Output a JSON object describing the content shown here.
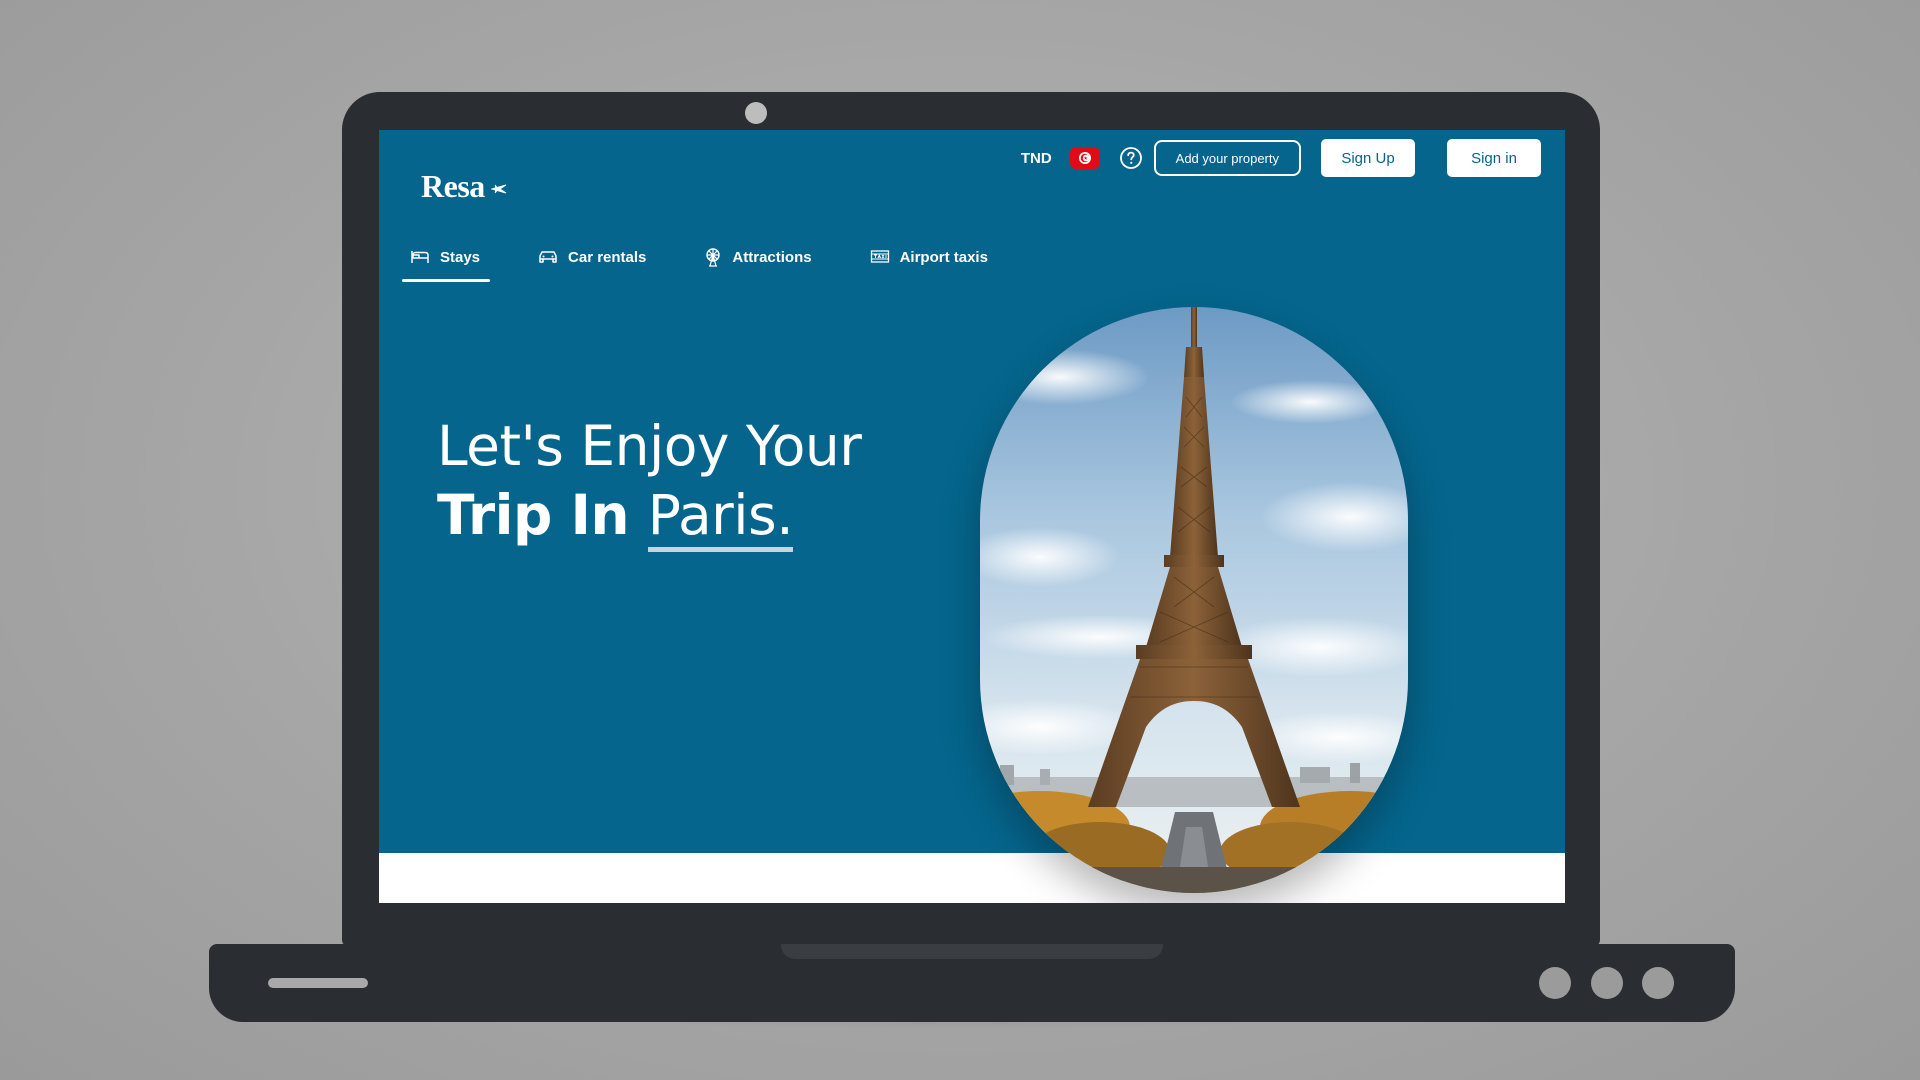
{
  "header": {
    "logo_text": "Resa",
    "currency": "TND",
    "add_property_label": "Add your property",
    "sign_up_label": "Sign Up",
    "sign_in_label": "Sign in"
  },
  "nav": {
    "tabs": [
      {
        "label": "Stays",
        "icon": "bed-icon",
        "active": true
      },
      {
        "label": "Car rentals",
        "icon": "car-icon",
        "active": false
      },
      {
        "label": "Attractions",
        "icon": "ferris-wheel-icon",
        "active": false
      },
      {
        "label": "Airport taxis",
        "icon": "taxi-icon",
        "active": false
      }
    ]
  },
  "hero": {
    "line1": "Let's Enjoy Your",
    "line2_prefix": "Trip In ",
    "line2_highlight": "Paris."
  },
  "colors": {
    "primary": "#05658c",
    "flag": "#e30a17",
    "bezel": "#2a2d32"
  }
}
